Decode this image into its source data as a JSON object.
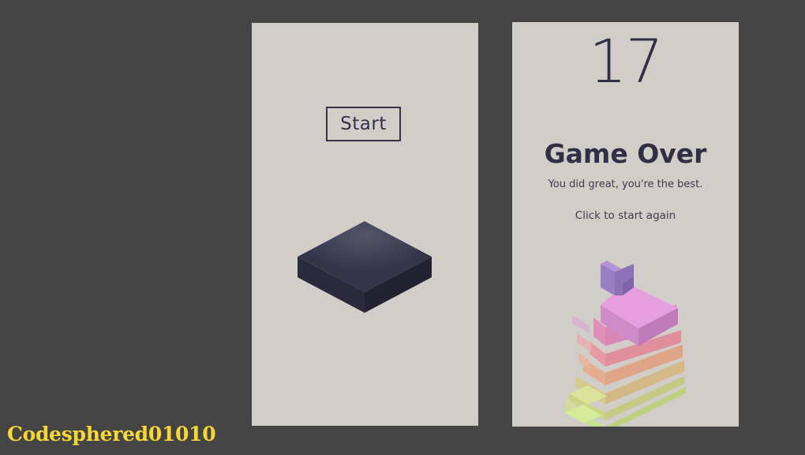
{
  "start_screen": {
    "start_label": "Start"
  },
  "game_over_screen": {
    "score": "17",
    "title": "Game Over",
    "message": "You did great, you're the best.",
    "restart_label": "Click to start again"
  },
  "watermark": "Codesphered01010",
  "colors": {
    "background": "#444444",
    "panel": "#d1cdc8",
    "text": "#2f2f45",
    "base_block": "#2b2b3e",
    "watermark": "#f7d736"
  }
}
